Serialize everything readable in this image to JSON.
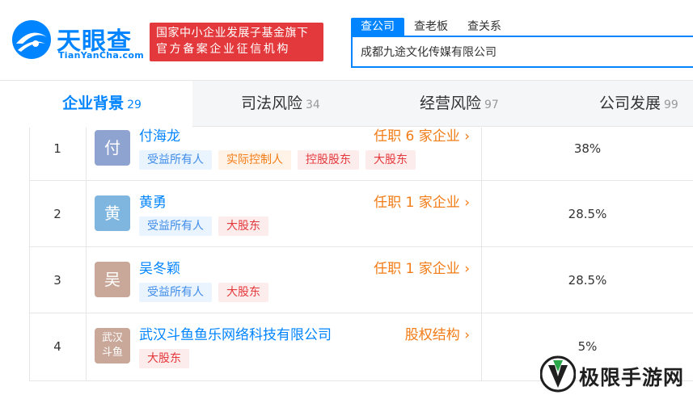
{
  "header": {
    "logo_text": "天眼查",
    "logo_sub": "TianYanCha.com",
    "slogan_line1": "国家中小企业发展子基金旗下",
    "slogan_line2": "官方备案企业征信机构",
    "search_tabs": [
      "查公司",
      "查老板",
      "查关系"
    ],
    "search_value": "成都九途文化传媒有限公司"
  },
  "tabs": [
    {
      "label": "企业背景",
      "count": "29"
    },
    {
      "label": "司法风险",
      "count": "34"
    },
    {
      "label": "经营风险",
      "count": "97"
    },
    {
      "label": "公司发展",
      "count": "99"
    }
  ],
  "rows": [
    {
      "num": "1",
      "avatar": "付",
      "avatar_color": "#8fa3d1",
      "name": "付海龙",
      "link": "任职 6 家企业",
      "tags": [
        {
          "text": "受益所有人",
          "kind": "blue"
        },
        {
          "text": "实际控制人",
          "kind": "orange"
        },
        {
          "text": "控股股东",
          "kind": "red"
        },
        {
          "text": "大股东",
          "kind": "red"
        }
      ],
      "pct": "38%"
    },
    {
      "num": "2",
      "avatar": "黄",
      "avatar_color": "#7fb6df",
      "name": "黄勇",
      "link": "任职 1 家企业",
      "tags": [
        {
          "text": "受益所有人",
          "kind": "blue"
        },
        {
          "text": "大股东",
          "kind": "red"
        }
      ],
      "pct": "28.5%"
    },
    {
      "num": "3",
      "avatar": "吴",
      "avatar_color": "#c9a89a",
      "name": "吴冬颖",
      "link": "任职 1 家企业",
      "tags": [
        {
          "text": "受益所有人",
          "kind": "blue"
        },
        {
          "text": "大股东",
          "kind": "red"
        }
      ],
      "pct": "28.5%"
    },
    {
      "num": "4",
      "avatar_line1": "武汉",
      "avatar_line2": "斗鱼",
      "avatar_color": "#c9a89a",
      "name": "武汉斗鱼鱼乐网络科技有限公司",
      "link": "股权结构",
      "tags": [
        {
          "text": "大股东",
          "kind": "red"
        }
      ],
      "pct": "5%"
    }
  ],
  "watermark": {
    "text": "极限手游网"
  },
  "colors": {
    "brand": "#0084ff",
    "slogan_bg": "#e4393c",
    "link_orange": "#f27c16"
  }
}
